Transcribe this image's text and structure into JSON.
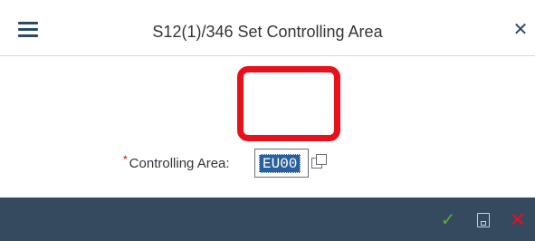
{
  "dialog": {
    "title": "S12(1)/346 Set Controlling Area",
    "close_icon": "close-icon",
    "menu_icon": "hamburger-menu-icon"
  },
  "form": {
    "controlling_area": {
      "required_marker": "*",
      "label": "Controlling Area:",
      "value": "EU00",
      "value_help_icon": "value-help-icon"
    }
  },
  "footer": {
    "buttons": [
      {
        "icon": "checkmark-icon",
        "glyph": "✓",
        "color": "#5ea63d"
      },
      {
        "icon": "save-icon"
      },
      {
        "icon": "cancel-icon",
        "glyph": "✕",
        "color": "#e8101a"
      }
    ]
  },
  "colors": {
    "footer_bg": "#354a5f",
    "highlight_box": "#e8101a",
    "selection_bg": "#2a5f9e"
  }
}
